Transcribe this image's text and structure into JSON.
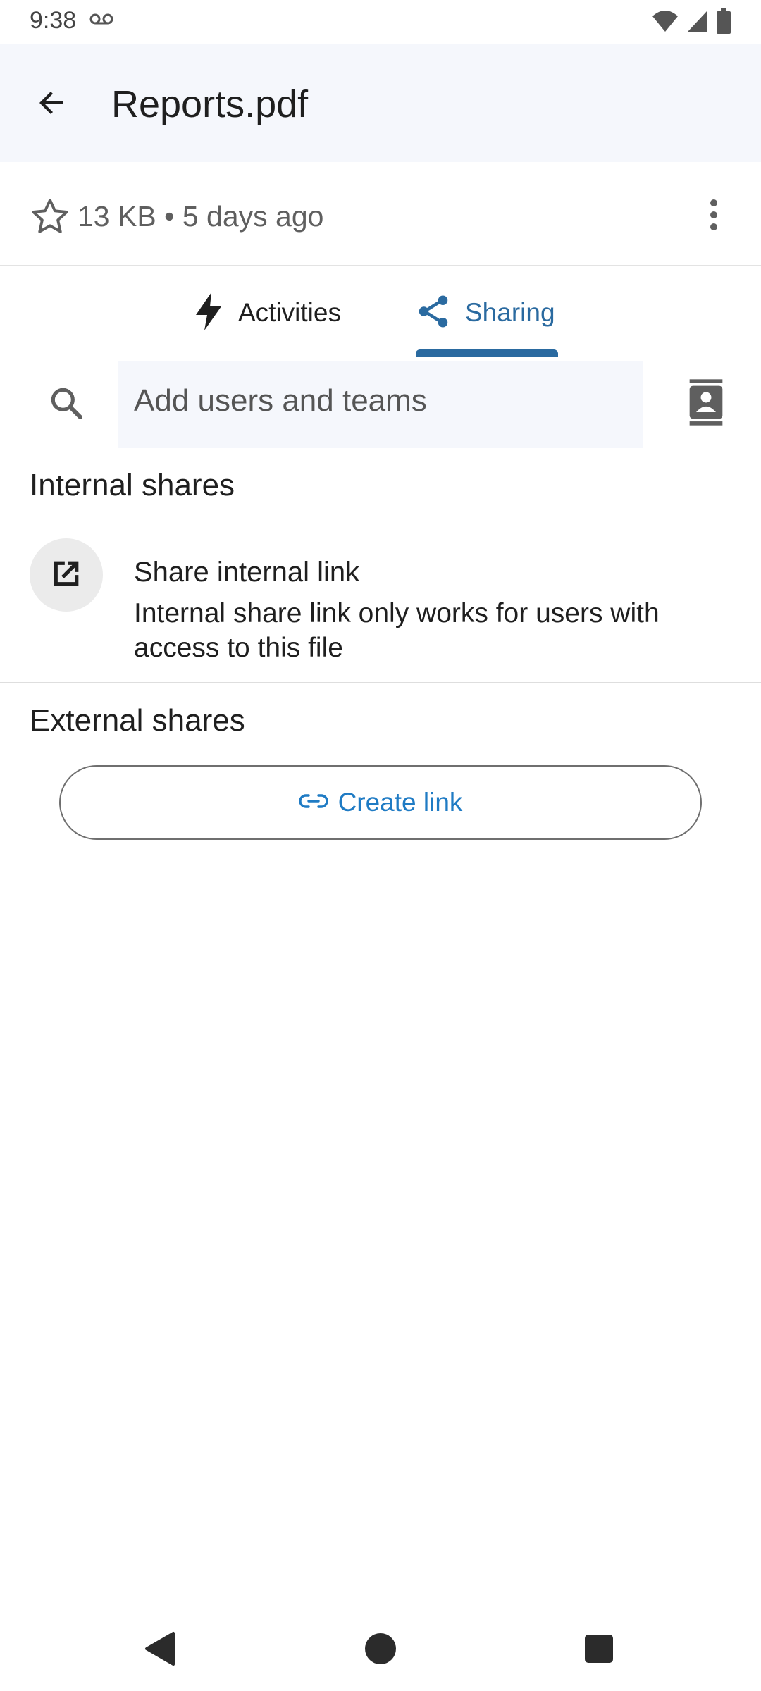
{
  "status_bar": {
    "time": "9:38",
    "icons": [
      "voicemail-icon",
      "wifi-icon",
      "signal-icon",
      "battery-icon"
    ]
  },
  "app_bar": {
    "title": "Reports.pdf",
    "back_icon": "arrow-back-icon"
  },
  "file_meta": {
    "info": "13 KB • 5 days ago",
    "star_icon": "star-outline-icon",
    "more_icon": "more-vert-icon"
  },
  "tabs": [
    {
      "label": "Activities",
      "icon": "bolt-icon",
      "selected": false
    },
    {
      "label": "Sharing",
      "icon": "share-icon",
      "selected": true
    }
  ],
  "search": {
    "placeholder": "Add users and teams",
    "contacts_icon": "contacts-icon"
  },
  "internal_shares": {
    "heading": "Internal shares",
    "link_title": "Share internal link",
    "link_description": "Internal share link only works for users with access to this file"
  },
  "external_shares": {
    "heading": "External shares",
    "create_link_label": "Create link"
  },
  "colors": {
    "accent": "#2a6aa0",
    "link": "#1f7bc4",
    "app_bar_bg": "#f5f7fc"
  }
}
